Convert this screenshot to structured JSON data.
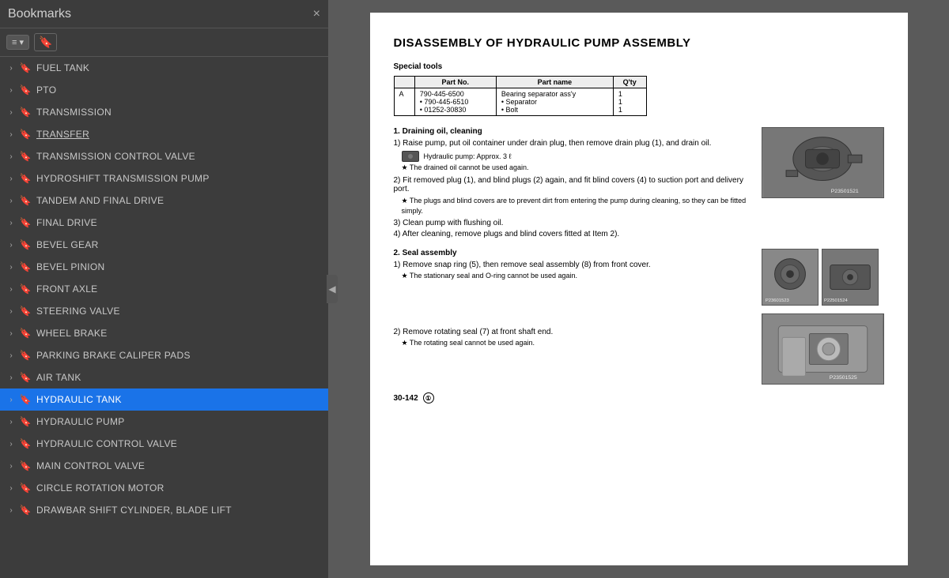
{
  "sidebar": {
    "title": "Bookmarks",
    "close_label": "×",
    "toolbar": {
      "btn1_label": "≡ ▾",
      "btn2_label": "🔖"
    },
    "items": [
      {
        "id": "fuel-tank",
        "label": "FUEL TANK",
        "indent": 0,
        "has_arrow": true,
        "active": false,
        "underline": false
      },
      {
        "id": "pto",
        "label": "PTO",
        "indent": 0,
        "has_arrow": true,
        "active": false,
        "underline": false
      },
      {
        "id": "transmission",
        "label": "TRANSMISSION",
        "indent": 0,
        "has_arrow": true,
        "active": false,
        "underline": false
      },
      {
        "id": "transfer",
        "label": "TRANSFER",
        "indent": 0,
        "has_arrow": true,
        "active": false,
        "underline": true
      },
      {
        "id": "transmission-control-valve",
        "label": "TRANSMISSION CONTROL VALVE",
        "indent": 0,
        "has_arrow": true,
        "active": false,
        "underline": false
      },
      {
        "id": "hydroshift-transmission-pump",
        "label": "HYDROSHIFT TRANSMISSION PUMP",
        "indent": 0,
        "has_arrow": true,
        "active": false,
        "underline": false
      },
      {
        "id": "tandem-and-final-drive",
        "label": "TANDEM AND FINAL DRIVE",
        "indent": 0,
        "has_arrow": true,
        "active": false,
        "underline": false
      },
      {
        "id": "final-drive",
        "label": "FINAL DRIVE",
        "indent": 0,
        "has_arrow": true,
        "active": false,
        "underline": false
      },
      {
        "id": "bevel-gear",
        "label": "BEVEL GEAR",
        "indent": 0,
        "has_arrow": true,
        "active": false,
        "underline": false
      },
      {
        "id": "bevel-pinion",
        "label": "BEVEL PINION",
        "indent": 0,
        "has_arrow": true,
        "active": false,
        "underline": false
      },
      {
        "id": "front-axle",
        "label": "FRONT AXLE",
        "indent": 0,
        "has_arrow": true,
        "active": false,
        "underline": false
      },
      {
        "id": "steering-valve",
        "label": "STEERING VALVE",
        "indent": 0,
        "has_arrow": true,
        "active": false,
        "underline": false
      },
      {
        "id": "wheel-brake",
        "label": "WHEEL BRAKE",
        "indent": 0,
        "has_arrow": true,
        "active": false,
        "underline": false
      },
      {
        "id": "parking-brake-caliper-pads",
        "label": "PARKING BRAKE CALIPER PADS",
        "indent": 0,
        "has_arrow": true,
        "active": false,
        "underline": false
      },
      {
        "id": "air-tank",
        "label": "AIR TANK",
        "indent": 0,
        "has_arrow": true,
        "active": false,
        "underline": false
      },
      {
        "id": "hydraulic-tank",
        "label": "HYDRAULIC TANK",
        "indent": 0,
        "has_arrow": true,
        "active": true,
        "underline": false
      },
      {
        "id": "hydraulic-pump",
        "label": "HYDRAULIC PUMP",
        "indent": 0,
        "has_arrow": true,
        "active": false,
        "underline": false
      },
      {
        "id": "hydraulic-control-valve",
        "label": "HYDRAULIC CONTROL VALVE",
        "indent": 0,
        "has_arrow": true,
        "active": false,
        "underline": false
      },
      {
        "id": "main-control-valve",
        "label": "MAIN CONTROL VALVE",
        "indent": 0,
        "has_arrow": true,
        "active": false,
        "underline": false
      },
      {
        "id": "circle-rotation-motor",
        "label": "CIRCLE ROTATION MOTOR",
        "indent": 0,
        "has_arrow": true,
        "active": false,
        "underline": false
      },
      {
        "id": "drawbar-shift",
        "label": "DRAWBAR SHIFT CYLINDER, BLADE LIFT",
        "indent": 0,
        "has_arrow": true,
        "active": false,
        "underline": false
      }
    ],
    "collapse_icon": "◀"
  },
  "document": {
    "title": "DISASSEMBLY OF HYDRAULIC PUMP ASSEMBLY",
    "special_tools_label": "Special tools",
    "table": {
      "headers": [
        "",
        "Part No.",
        "Part name",
        "Q'ty"
      ],
      "rows": [
        {
          "col0": "A",
          "col1": "790-445-6500",
          "col1b": "• 790-445-6510",
          "col1c": "• 01252-30830",
          "col2": "Bearing separator ass'y",
          "col2b": "• Separator",
          "col2c": "• Bolt",
          "col3": "1",
          "col3b": "1",
          "col3c": "1"
        }
      ]
    },
    "section1": {
      "heading": "1.  Draining oil, cleaning",
      "steps": [
        {
          "num": "1)",
          "text": "Raise pump, put oil container under drain plug, then remove drain plug (1), and drain oil."
        },
        {
          "note": "Hydraulic pump: Approx. 3 ℓ"
        },
        {
          "star": "★  The drained oil cannot be used again."
        },
        {
          "num": "2)",
          "text": "Fit removed plug (1), and blind plugs (2) again, and fit blind covers (4) to suction port and delivery port."
        },
        {
          "star": "★  The plugs and blind covers are to prevent dirt from entering the pump during cleaning, so they can be fitted simply."
        },
        {
          "num": "3)",
          "text": "Clean pump with flushing oil."
        },
        {
          "num": "4)",
          "text": "After cleaning, remove plugs and blind covers fitted at Item 2)."
        }
      ],
      "image_label": "P23501521"
    },
    "section2": {
      "heading": "2.  Seal assembly",
      "steps": [
        {
          "num": "1)",
          "text": "Remove snap ring (5), then remove seal assembly (8) from front cover."
        },
        {
          "star": "★  The stationary seal and O-ring cannot be used again."
        },
        {
          "num": "2)",
          "text": "Remove rotating seal (7) at front shaft end."
        },
        {
          "star": "★  The rotating seal cannot be used again."
        }
      ],
      "image_labels": [
        "P23601523",
        "P22501524"
      ],
      "image_label3": "P23501525"
    },
    "page_number": "30-142",
    "page_circle": "①"
  }
}
